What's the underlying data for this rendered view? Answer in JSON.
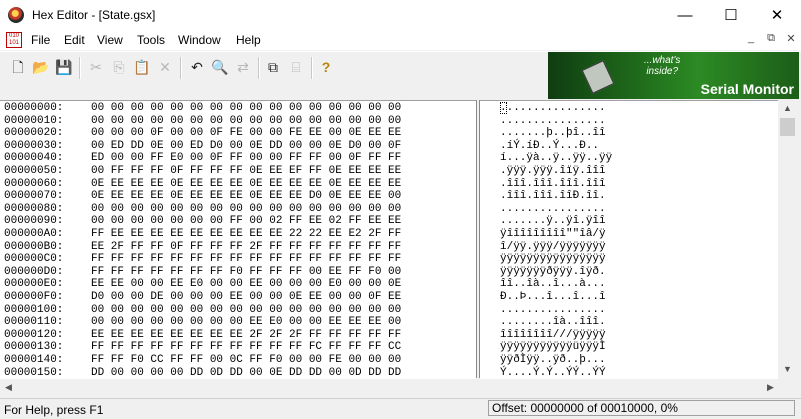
{
  "window": {
    "title": "Hex Editor - [State.gsx]",
    "minimize": "—",
    "maximize": "☐",
    "close": "✕"
  },
  "menu": {
    "items": [
      "File",
      "Edit",
      "View",
      "Tools",
      "Window",
      "Help"
    ],
    "mdi_min": "_",
    "mdi_restore": "⧉",
    "mdi_close": "✕"
  },
  "toolbar": {
    "icons": [
      "new-file",
      "open-folder",
      "save",
      "cut",
      "copy",
      "paste",
      "delete",
      "undo",
      "find",
      "replace",
      "browse",
      "bookmark",
      "help"
    ],
    "glyphs": [
      "🗋",
      "📂",
      "💾",
      "✂",
      "⎘",
      "📋",
      "✕",
      "↶",
      "🔍",
      "⇄",
      "⧉",
      "⌸",
      "?"
    ]
  },
  "banner": {
    "tagline": "...what's\ninside?",
    "label": "Serial Monitor"
  },
  "hex_rows": [
    {
      "offset": "00000000:",
      "bytes": "00 00 00 00 00 00 00 00 00 00 00 00 00 00 00 00",
      "ascii": "................"
    },
    {
      "offset": "00000010:",
      "bytes": "00 00 00 00 00 00 00 00 00 00 00 00 00 00 00 00",
      "ascii": "................"
    },
    {
      "offset": "00000020:",
      "bytes": "00 00 00 0F 00 00 0F FE 00 00 FE EE 00 0E EE EE",
      "ascii": ".......þ..þî..îî"
    },
    {
      "offset": "00000030:",
      "bytes": "00 ED DD 0E 00 ED D0 00 0E DD 00 00 0E D0 00 0F",
      "ascii": ".íÝ.íÐ..Ý...Ð.."
    },
    {
      "offset": "00000040:",
      "bytes": "ED 00 00 FF E0 00 0F FF 00 00 FF FF 00 0F FF FF",
      "ascii": "í...ÿà..ÿ..ÿÿ..ÿÿ"
    },
    {
      "offset": "00000050:",
      "bytes": "00 FF FF FF 0F FF FF FF 0E EE EF FF 0E EE EE EE",
      "ascii": ".ÿÿÿ.ÿÿÿ.îïÿ.îîî"
    },
    {
      "offset": "00000060:",
      "bytes": "0E EE EE EE 0E EE EE EE 0E EE EE EE 0E EE EE EE",
      "ascii": ".îîî.îîî.îîî.îîî"
    },
    {
      "offset": "00000070:",
      "bytes": "0E EE EE EE 0E EE EE EE 0E EE EE D0 0E EE EE 00",
      "ascii": ".îîî.îîî.îîÐ.îî."
    },
    {
      "offset": "00000080:",
      "bytes": "00 00 00 00 00 00 00 00 00 00 00 00 00 00 00 00",
      "ascii": "................"
    },
    {
      "offset": "00000090:",
      "bytes": "00 00 00 00 00 00 00 FF 00 02 FF EE 02 FF EE EE",
      "ascii": ".......ÿ..ÿî.ÿîî"
    },
    {
      "offset": "000000A0:",
      "bytes": "FF EE EE EE EE EE EE EE EE EE 22 22 EE E2 2F FF",
      "ascii": "ÿîîîîîîîîî\"\"îâ/ÿ"
    },
    {
      "offset": "000000B0:",
      "bytes": "EE 2F FF FF 0F FF FF FF 2F FF FF FF FF FF FF FF",
      "ascii": "î/ÿÿ.ÿÿÿ/ÿÿÿÿÿÿÿ"
    },
    {
      "offset": "000000C0:",
      "bytes": "FF FF FF FF FF FF FF FF FF FF FF FF FF FF FF FF",
      "ascii": "ÿÿÿÿÿÿÿÿÿÿÿÿÿÿÿÿ"
    },
    {
      "offset": "000000D0:",
      "bytes": "FF FF FF FF FF FF FF F0 FF FF FF 00 EE FF F0 00",
      "ascii": "ÿÿÿÿÿÿÿðÿÿÿ.îÿð."
    },
    {
      "offset": "000000E0:",
      "bytes": "EE EE 00 00 EE E0 00 00 EE 00 00 00 E0 00 00 0E",
      "ascii": "îî..îà..î...à..."
    },
    {
      "offset": "000000F0:",
      "bytes": "D0 00 00 DE 00 00 00 EE 00 00 0E EE 00 00 0F EE",
      "ascii": "Ð..Þ...î...î...î"
    },
    {
      "offset": "00000100:",
      "bytes": "00 00 00 00 00 00 00 00 00 00 00 00 00 00 00 00",
      "ascii": "................"
    },
    {
      "offset": "00000110:",
      "bytes": "00 00 00 00 00 00 00 00 EE E0 00 00 EE EE EE 00",
      "ascii": "........îà..îîî."
    },
    {
      "offset": "00000120:",
      "bytes": "EE EE EE EE EE EE EE EE 2F 2F 2F FF FF FF FF FF",
      "ascii": "îîîîîîîî///ÿÿÿÿÿ"
    },
    {
      "offset": "00000130:",
      "bytes": "FF FF FF FF FF FF FF FF FF FF FF FC FF FF FF CC",
      "ascii": "ÿÿÿÿÿÿÿÿÿÿÿüÿÿÿÌ"
    },
    {
      "offset": "00000140:",
      "bytes": "FF FF F0 CC FF FF 00 0C FF F0 00 00 FE 00 00 00",
      "ascii": "ÿÿðÌÿÿ..ÿð..þ..."
    },
    {
      "offset": "00000150:",
      "bytes": "DD 00 00 00 00 DD 0D DD 00 0E DD DD 00 0D DD DD",
      "ascii": "Ý....Ý.Ý..ÝÝ..ÝÝ"
    }
  ],
  "scroll": {
    "up": "▲",
    "down": "▼",
    "left": "◀",
    "right": "▶"
  },
  "status": {
    "help": "For Help, press F1",
    "offset": "Offset: 00000000 of 00010000, 0%"
  }
}
